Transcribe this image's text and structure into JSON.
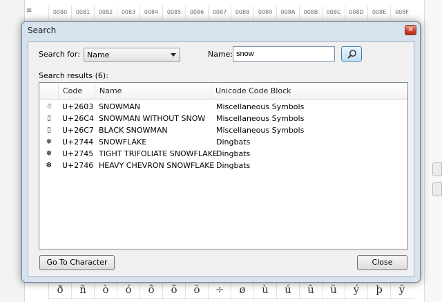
{
  "background": {
    "column_headers": [
      "0080",
      "0081",
      "0082",
      "0083",
      "0084",
      "0085",
      "0086",
      "0087",
      "0088",
      "0089",
      "008A",
      "008B",
      "008C",
      "008D",
      "008E",
      "008F"
    ],
    "bottom_glyphs": [
      "ð",
      "ñ",
      "ò",
      "ó",
      "ô",
      "õ",
      "ö",
      "÷",
      "ø",
      "ù",
      "ú",
      "û",
      "ü",
      "ý",
      "þ",
      "ÿ"
    ]
  },
  "dialog": {
    "title": "Search",
    "close_glyph": "✕",
    "search_for_label": "Search for:",
    "search_for_value": "Name",
    "name_label": "Name:",
    "name_value": "snow",
    "results_label": "Search results (6):",
    "columns": [
      "",
      "Code",
      "Name",
      "Unicode Code Block"
    ],
    "results": [
      {
        "glyph": "☃",
        "code": "U+2603",
        "name": "SNOWMAN",
        "block": "Miscellaneous Symbols"
      },
      {
        "glyph": "▯",
        "code": "U+26C4",
        "name": "SNOWMAN WITHOUT SNOW",
        "block": "Miscellaneous Symbols"
      },
      {
        "glyph": "▯",
        "code": "U+26C7",
        "name": "BLACK SNOWMAN",
        "block": "Miscellaneous Symbols"
      },
      {
        "glyph": "❄",
        "code": "U+2744",
        "name": "SNOWFLAKE",
        "block": "Dingbats"
      },
      {
        "glyph": "❅",
        "code": "U+2745",
        "name": "TIGHT TRIFOLIATE SNOWFLAKE",
        "block": "Dingbats"
      },
      {
        "glyph": "❆",
        "code": "U+2746",
        "name": "HEAVY CHEVRON SNOWFLAKE",
        "block": "Dingbats"
      }
    ],
    "go_to_label": "Go To Character",
    "close_label": "Close"
  },
  "colors": {
    "dialog_frame": "#d7e2ef",
    "close_button": "#c8442e",
    "search_button": "#bfe0f6"
  }
}
